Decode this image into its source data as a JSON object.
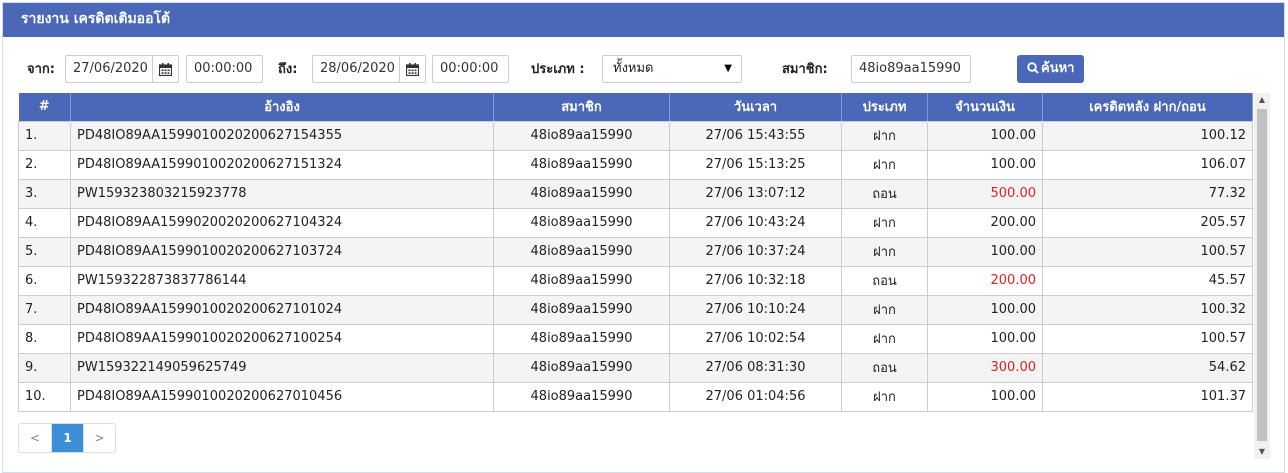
{
  "header": {
    "title": "รายงาน เครดิตเติมออโต้"
  },
  "filter": {
    "from_label": "จาก:",
    "from_date": "27/06/2020",
    "from_time": "00:00:00",
    "to_label": "ถึง:",
    "to_date": "28/06/2020",
    "to_time": "00:00:00",
    "type_label": "ประเภท :",
    "type_value": "ทั้งหมด",
    "member_label": "สมาชิก:",
    "member_value": "48io89aa15990",
    "search_label": "ค้นหา"
  },
  "table": {
    "columns": [
      "#",
      "อ้างอิง",
      "สมาชิก",
      "วันเวลา",
      "ประเภท",
      "จำนวนเงิน",
      "เครดิตหลัง ฝาก/ถอน"
    ],
    "rows": [
      {
        "no": "1.",
        "ref": "PD48IO89AA159901002020062715435 5",
        "member": "48io89aa15990",
        "time": "27/06 15:43:55",
        "type": "ฝาก",
        "amount": "100.00",
        "after": "100.12",
        "withdraw": false
      },
      {
        "no": "2.",
        "ref": "PD48IO89AA1599010020200627151324",
        "member": "48io89aa15990",
        "time": "27/06 15:13:25",
        "type": "ฝาก",
        "amount": "100.00",
        "after": "106.07",
        "withdraw": false
      },
      {
        "no": "3.",
        "ref": "PW159323803215923778",
        "member": "48io89aa15990",
        "time": "27/06 13:07:12",
        "type": "ถอน",
        "amount": "500.00",
        "after": "77.32",
        "withdraw": true
      },
      {
        "no": "4.",
        "ref": "PD48IO89AA1599020020200627104324",
        "member": "48io89aa15990",
        "time": "27/06 10:43:24",
        "type": "ฝาก",
        "amount": "200.00",
        "after": "205.57",
        "withdraw": false
      },
      {
        "no": "5.",
        "ref": "PD48IO89AA1599010020200627103724",
        "member": "48io89aa15990",
        "time": "27/06 10:37:24",
        "type": "ฝาก",
        "amount": "100.00",
        "after": "100.57",
        "withdraw": false
      },
      {
        "no": "6.",
        "ref": "PW159322873837786144",
        "member": "48io89aa15990",
        "time": "27/06 10:32:18",
        "type": "ถอน",
        "amount": "200.00",
        "after": "45.57",
        "withdraw": true
      },
      {
        "no": "7.",
        "ref": "PD48IO89AA1599010020200627101024",
        "member": "48io89aa15990",
        "time": "27/06 10:10:24",
        "type": "ฝาก",
        "amount": "100.00",
        "after": "100.32",
        "withdraw": false
      },
      {
        "no": "8.",
        "ref": "PD48IO89AA1599010020200627100254",
        "member": "48io89aa15990",
        "time": "27/06 10:02:54",
        "type": "ฝาก",
        "amount": "100.00",
        "after": "100.57",
        "withdraw": false
      },
      {
        "no": "9.",
        "ref": "PW159322149059625749",
        "member": "48io89aa15990",
        "time": "27/06 08:31:30",
        "type": "ถอน",
        "amount": "300.00",
        "after": "54.62",
        "withdraw": true
      },
      {
        "no": "10.",
        "ref": "PD48IO89AA1599010020200627010456",
        "member": "48io89aa15990",
        "time": "27/06 01:04:56",
        "type": "ฝาก",
        "amount": "100.00",
        "after": "101.37",
        "withdraw": false
      }
    ]
  },
  "pager": {
    "prev": "<",
    "current": "1",
    "next": ">"
  },
  "colors": {
    "accent": "#4a67b8",
    "withdraw": "#e02020",
    "pager_active": "#3b8fd6"
  },
  "icons": {
    "calendar": "calendar-icon",
    "search": "search-icon"
  }
}
